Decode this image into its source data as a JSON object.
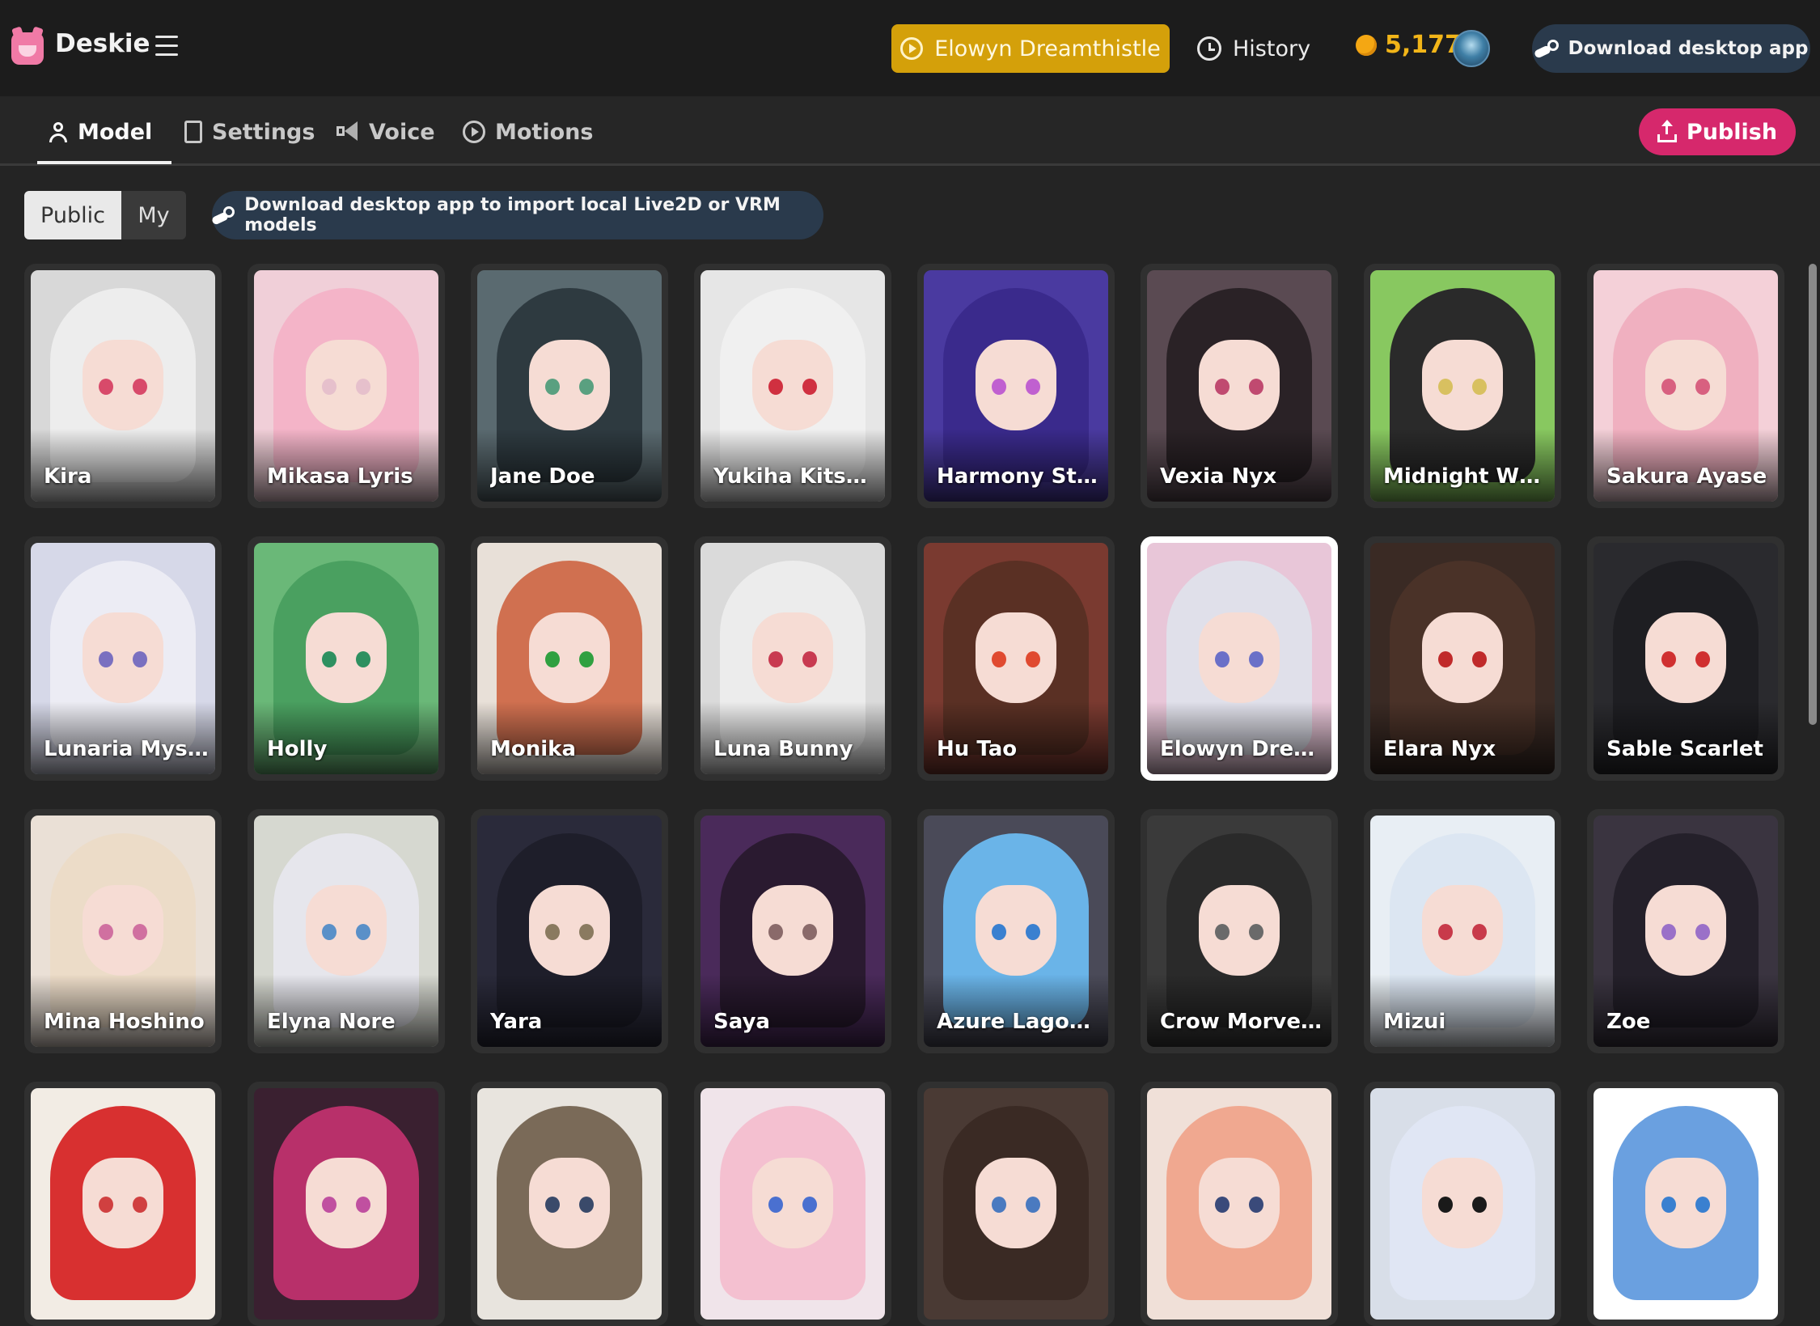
{
  "header": {
    "brand": "Deskie",
    "current_character": "Elowyn Dreamthistle",
    "history_label": "History",
    "coins": "5,177",
    "download_label": "Download desktop app"
  },
  "tabs": [
    {
      "label": "Model",
      "icon": "user-icon"
    },
    {
      "label": "Settings",
      "icon": "document-icon"
    },
    {
      "label": "Voice",
      "icon": "megaphone-icon"
    },
    {
      "label": "Motions",
      "icon": "play-icon"
    }
  ],
  "publish_label": "Publish",
  "filter": {
    "public": "Public",
    "my": "My"
  },
  "import_banner": "Download desktop app to import local Live2D or VRM models",
  "models": [
    {
      "name": "Kira",
      "hair": "#ededed",
      "bg": "#d8d8d8",
      "eye": "#d84a6a"
    },
    {
      "name": "Mikasa Lyris",
      "hair": "#f4b4c8",
      "bg": "#f0cfd8",
      "eye": "#e6c0cc"
    },
    {
      "name": "Jane Doe",
      "hair": "#2e3a40",
      "bg": "#5a6a70",
      "eye": "#5aa080"
    },
    {
      "name": "Yukiha Kitsune",
      "hair": "#f0f0f0",
      "bg": "#e6e6e6",
      "eye": "#d03040"
    },
    {
      "name": "Harmony Starlight",
      "hair": "#3a2a8c",
      "bg": "#4a3aa0",
      "eye": "#c060d0"
    },
    {
      "name": "Vexia Nyx",
      "hair": "#2a2226",
      "bg": "#5a4a52",
      "eye": "#c04a70"
    },
    {
      "name": "Midnight Whisker",
      "hair": "#2a2a2a",
      "bg": "#88c860",
      "eye": "#d8c060"
    },
    {
      "name": "Sakura Ayase",
      "hair": "#f0b0c0",
      "bg": "#f4d0d8",
      "eye": "#d86080"
    },
    {
      "name": "Lunaria Mystwood",
      "hair": "#ececf4",
      "bg": "#d6d8e8",
      "eye": "#7a70c0"
    },
    {
      "name": "Holly",
      "hair": "#4aa060",
      "bg": "#6ab878",
      "eye": "#2e9060"
    },
    {
      "name": "Monika",
      "hair": "#d07050",
      "bg": "#e8e0d8",
      "eye": "#30a040"
    },
    {
      "name": "Luna Bunny",
      "hair": "#ececec",
      "bg": "#dadada",
      "eye": "#c83a50"
    },
    {
      "name": "Hu Tao",
      "hair": "#5a3024",
      "bg": "#7a3a30",
      "eye": "#e04a30"
    },
    {
      "name": "Elowyn Dreamthistle",
      "hair": "#e0e0ea",
      "bg": "#e8c6d8",
      "eye": "#6a70c8"
    },
    {
      "name": "Elara Nyx",
      "hair": "#4a3228",
      "bg": "#3a2a24",
      "eye": "#c02a2a"
    },
    {
      "name": "Sable Scarlet",
      "hair": "#1e1e22",
      "bg": "#2a2a2e",
      "eye": "#d03030"
    },
    {
      "name": "Mina Hoshino",
      "hair": "#ecdcc8",
      "bg": "#eae0d6",
      "eye": "#d070a0"
    },
    {
      "name": "Elyna Nore",
      "hair": "#e6e6ec",
      "bg": "#d6d8d0",
      "eye": "#5a90c8"
    },
    {
      "name": "Yara",
      "hair": "#1e1e2a",
      "bg": "#2a2a3a",
      "eye": "#8a7a60"
    },
    {
      "name": "Saya",
      "hair": "#2a1a30",
      "bg": "#4a2a5a",
      "eye": "#8a6a6a"
    },
    {
      "name": "Azure Lagomorph",
      "hair": "#6ab4e8",
      "bg": "#4a4a58",
      "eye": "#3a80d0"
    },
    {
      "name": "Crow Morveren",
      "hair": "#2a2a2a",
      "bg": "#3a3a3a",
      "eye": "#6a6a6a"
    },
    {
      "name": "Mizui",
      "hair": "#dce6f2",
      "bg": "#e8eef4",
      "eye": "#c83a4a"
    },
    {
      "name": "Zoe",
      "hair": "#24202a",
      "bg": "#3a3440",
      "eye": "#9a70c8"
    },
    {
      "name": "",
      "hair": "#d83030",
      "bg": "#f2ece4",
      "eye": "#d04040"
    },
    {
      "name": "",
      "hair": "#b8306a",
      "bg": "#3a2030",
      "eye": "#c050a0"
    },
    {
      "name": "",
      "hair": "#7a6a58",
      "bg": "#e8e4de",
      "eye": "#3a4a6a"
    },
    {
      "name": "",
      "hair": "#f4c0d0",
      "bg": "#f0e4ea",
      "eye": "#4a70d0"
    },
    {
      "name": "",
      "hair": "#3a2a24",
      "bg": "#4a3a34",
      "eye": "#4a7ac0"
    },
    {
      "name": "",
      "hair": "#f0a890",
      "bg": "#f0e0d8",
      "eye": "#3a4a7a"
    },
    {
      "name": "",
      "hair": "#e0e6f4",
      "bg": "#d8dee8",
      "eye": "#1a1a1a"
    },
    {
      "name": "",
      "hair": "#6aa0e0",
      "bg": "#ffffff",
      "eye": "#3a80d0"
    }
  ]
}
